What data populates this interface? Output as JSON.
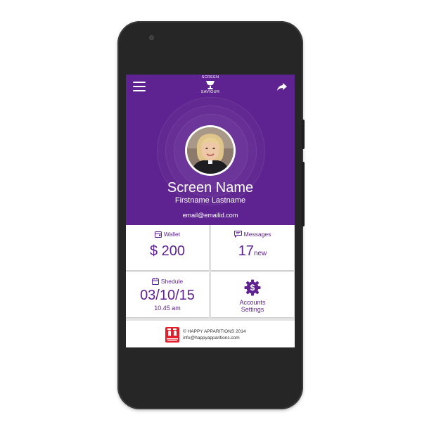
{
  "header": {
    "logo_top": "SCREEN",
    "logo_bottom": "SAVIOUR",
    "menu_icon": "hamburger-menu-icon",
    "share_icon": "share-arrow-icon",
    "background_color": "#5e2390"
  },
  "profile": {
    "screen_name": "Screen Name",
    "full_name": "Firstname Lastname",
    "email": "email@emailid.com"
  },
  "tiles": {
    "wallet": {
      "label": "Wallet",
      "value": "$ 200",
      "icon": "wallet-icon"
    },
    "messages": {
      "label": "Messages",
      "count": "17",
      "suffix": "new",
      "icon": "message-icon"
    },
    "schedule": {
      "label": "Shedule",
      "date": "03/10/15",
      "time": "10.45 am",
      "icon": "calendar-icon"
    },
    "accounts": {
      "label_line1": "Accounts",
      "label_line2": "Settings",
      "icon": "dollar-gear-icon"
    }
  },
  "footer": {
    "copyright": "© HAPPY APPARITIONS 2014",
    "email": "info@happyapparitions.com",
    "logo_icon": "happy-apparitions-logo-icon",
    "logo_color": "#e3202a"
  },
  "colors": {
    "accent": "#5e2390",
    "tile_bg": "#ffffff",
    "divider": "#e4e4e4"
  }
}
